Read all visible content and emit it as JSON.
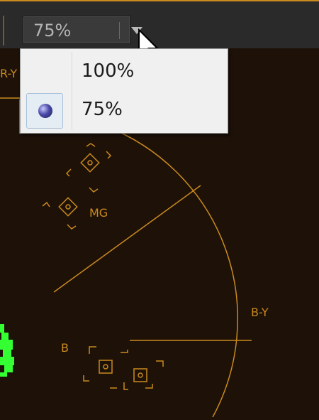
{
  "toolbar": {
    "zoom_value": "75%",
    "dropdown_icon": "chevron-down-icon"
  },
  "zoom_menu": {
    "items": [
      {
        "label": "100%",
        "selected": false
      },
      {
        "label": "75%",
        "selected": true
      }
    ]
  },
  "vectorscope": {
    "labels": {
      "ry": "R-Y",
      "mg": "MG",
      "by": "B-Y",
      "b": "B"
    },
    "graticule_color": "#c98a1e",
    "trace_color": "#33ff33"
  }
}
